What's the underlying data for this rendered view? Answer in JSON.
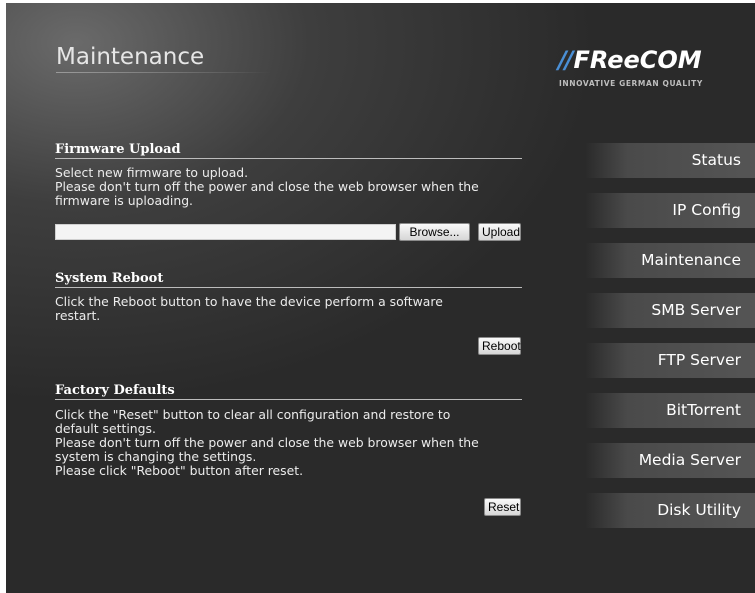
{
  "header": {
    "title": "Maintenance",
    "logo_mark": "//",
    "logo_text": "FReeCOM",
    "logo_tagline": "INNOVATIVE GERMAN QUALITY"
  },
  "firmware": {
    "title": "Firmware Upload",
    "lines": [
      "Select new firmware to upload.",
      "Please don't turn off the power and close the web browser when the",
      "firmware is uploading."
    ],
    "file_value": "",
    "browse_label": "Browse...",
    "upload_label": "Upload"
  },
  "reboot": {
    "title": "System Reboot",
    "lines": [
      "Click the Reboot button to have the device perform a software",
      "restart."
    ],
    "button_label": "Reboot"
  },
  "factory": {
    "title": "Factory Defaults",
    "lines": [
      "Click the \"Reset\" button to clear all configuration and restore to",
      "default settings.",
      "Please don't turn off the power and close the web browser when the",
      "system is changing the settings.",
      "Please click \"Reboot\" button after reset."
    ],
    "button_label": "Reset"
  },
  "nav": {
    "items": [
      {
        "label": "Status"
      },
      {
        "label": "IP Config"
      },
      {
        "label": "Maintenance"
      },
      {
        "label": "SMB Server"
      },
      {
        "label": "FTP Server"
      },
      {
        "label": "BitTorrent"
      },
      {
        "label": "Media Server"
      },
      {
        "label": "Disk Utility"
      }
    ]
  }
}
